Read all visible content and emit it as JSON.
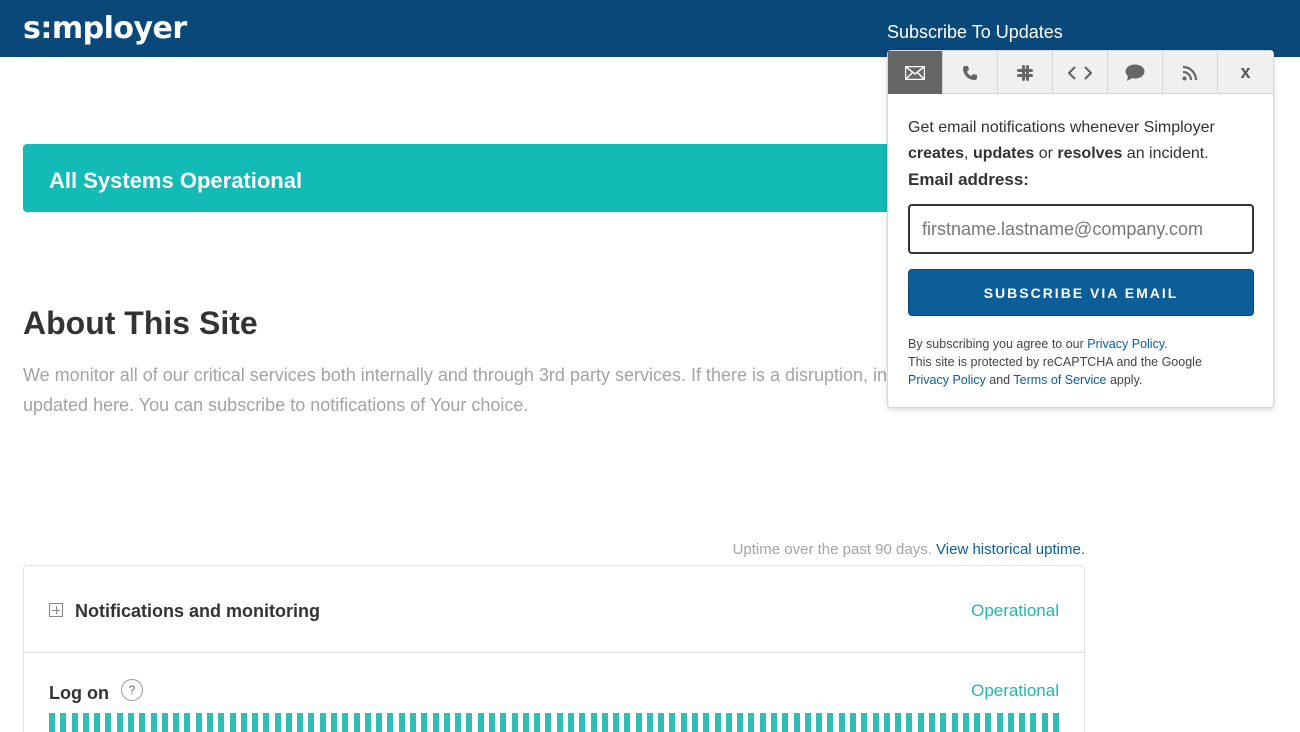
{
  "header": {
    "logo": "s:mployer",
    "subscribe_label": "Subscribe To Updates"
  },
  "status_banner": {
    "text": "All Systems Operational"
  },
  "about": {
    "title": "About This Site",
    "text": "We monitor all of our critical services both internally and through 3rd party services. If there is a disruption, incident notes will be updated here. You can subscribe to notifications of Your choice."
  },
  "uptime": {
    "note": "Uptime over the past 90 days.",
    "link": "View historical uptime."
  },
  "components": [
    {
      "name": "Notifications and monitoring",
      "status": "Operational"
    },
    {
      "name": "Log on",
      "status": "Operational",
      "help": "?"
    }
  ],
  "popup": {
    "tabs": [
      "email-icon",
      "phone-icon",
      "slack-icon",
      "code-icon",
      "chat-icon",
      "rss-icon",
      "close-icon"
    ],
    "close_label": "x",
    "desc_1": "Get email notifications whenever Simployer",
    "desc_creates": "creates",
    "desc_comma": ", ",
    "desc_updates": "updates",
    "desc_or": " or ",
    "desc_resolves": "resolves",
    "desc_end": " an incident.",
    "email_label": "Email address:",
    "email_placeholder": "firstname.lastname@company.com",
    "button": "SUBSCRIBE VIA EMAIL",
    "legal_1": "By subscribing you agree to our ",
    "legal_privacy": "Privacy Policy",
    "legal_2": "This site is protected by reCAPTCHA and the Google ",
    "legal_privacy2": "Privacy Policy",
    "legal_and": " and ",
    "legal_terms": "Terms of Service",
    "legal_apply": " apply."
  },
  "colors": {
    "header": "#0a4879",
    "banner": "#12bbb6",
    "operational": "#21b8aa",
    "button": "#0c5e99"
  }
}
